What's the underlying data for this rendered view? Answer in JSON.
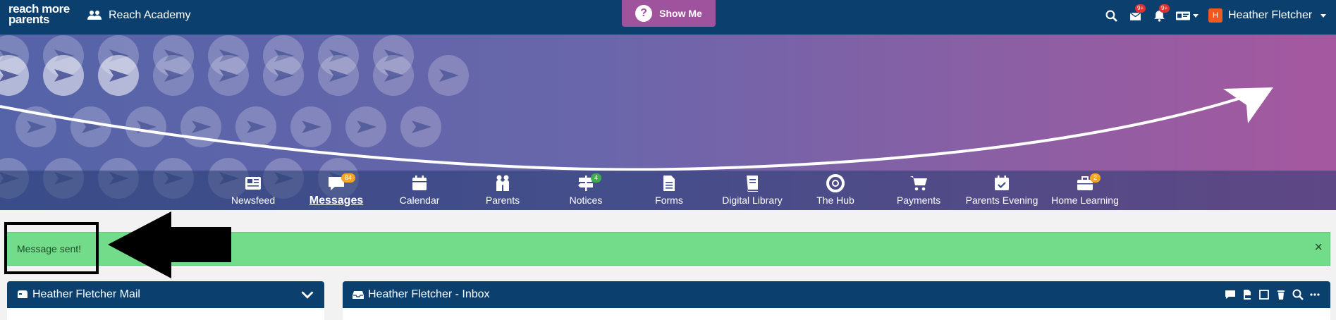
{
  "app": {
    "logo_line1": "reach more",
    "logo_line2": "parents",
    "school_name": "Reach Academy",
    "show_me_label": "Show Me",
    "show_me_icon": "?"
  },
  "top_icons": [
    {
      "name": "search-icon"
    },
    {
      "name": "mail-icon",
      "badge": "9+"
    },
    {
      "name": "bell-icon",
      "badge": "9+"
    },
    {
      "name": "id-card-icon"
    }
  ],
  "user": {
    "initial": "H",
    "name": "Heather Fletcher"
  },
  "nav": [
    {
      "key": "newsfeed",
      "label": "Newsfeed",
      "icon": "newspaper-icon"
    },
    {
      "key": "messages",
      "label": "Messages",
      "icon": "chat-icon",
      "count": "84",
      "active": true
    },
    {
      "key": "calendar",
      "label": "Calendar",
      "icon": "calendar-icon"
    },
    {
      "key": "parents",
      "label": "Parents",
      "icon": "family-icon"
    },
    {
      "key": "notices",
      "label": "Notices",
      "icon": "signpost-icon",
      "count": "4"
    },
    {
      "key": "forms",
      "label": "Forms",
      "icon": "document-icon"
    },
    {
      "key": "digital-library",
      "label": "Digital Library",
      "icon": "book-icon"
    },
    {
      "key": "the-hub",
      "label": "The Hub",
      "icon": "lifebuoy-icon"
    },
    {
      "key": "payments",
      "label": "Payments",
      "icon": "cart-icon"
    },
    {
      "key": "parents-evening",
      "label": "Parents Evening",
      "icon": "calendar-check-icon"
    },
    {
      "key": "home-learning",
      "label": "Home Learning",
      "icon": "briefcase-icon",
      "count": "2"
    }
  ],
  "colors": {
    "topbar": "#0b3f6d",
    "show_me": "#a0539d",
    "badge_orange": "#f6a623",
    "badge_green": "#3cae4b",
    "alert_bg": "#72dc8a"
  },
  "alert": {
    "text": "Message sent!",
    "close": "×"
  },
  "panels": {
    "left_title": "Heather Fletcher Mail",
    "right_title": "Heather Fletcher - Inbox"
  }
}
